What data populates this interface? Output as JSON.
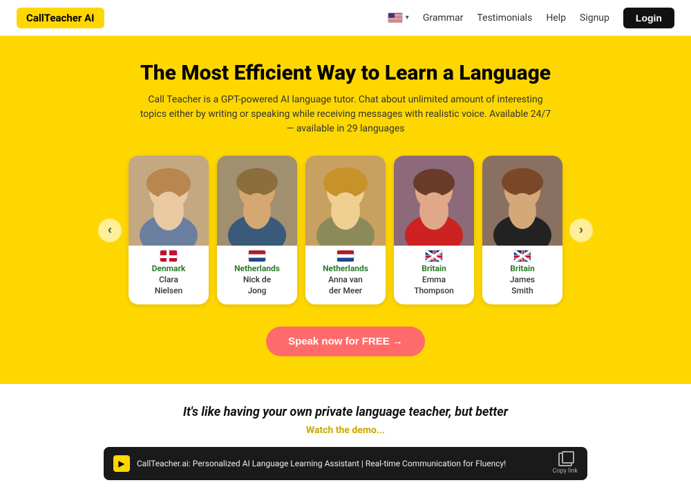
{
  "brand": {
    "logo": "CallTeacher AI"
  },
  "nav": {
    "links": [
      "Grammar",
      "Testimonials",
      "Help",
      "Signup"
    ],
    "login_label": "Login",
    "flag_alt": "US Flag"
  },
  "hero": {
    "title": "The Most Efficient Way to Learn a Language",
    "subtitle": "Call Teacher is a GPT-powered AI language tutor. Chat about unlimited amount of interesting topics either by writing or speaking while receiving messages with realistic voice. Available 24/7 — available in 29 languages",
    "carousel_prev": "‹",
    "carousel_next": "›",
    "cta_label": "Speak now for FREE →"
  },
  "teachers": [
    {
      "country": "Denmark",
      "country_color": "#2a7a2a",
      "name": "Clara\nNielsen",
      "flag_type": "dk",
      "emoji": "👩"
    },
    {
      "country": "Netherlands",
      "country_color": "#2a7a2a",
      "name": "Nick de\nJong",
      "flag_type": "nl",
      "emoji": "👨"
    },
    {
      "country": "Netherlands",
      "country_color": "#2a7a2a",
      "name": "Anna van\nder Meer",
      "flag_type": "nl",
      "emoji": "👩"
    },
    {
      "country": "Britain",
      "country_color": "#2a7a2a",
      "name": "Emma\nThompson",
      "flag_type": "gb",
      "emoji": "👩"
    },
    {
      "country": "Britain",
      "country_color": "#2a7a2a",
      "name": "James\nSmith",
      "flag_type": "gb",
      "emoji": "👨"
    }
  ],
  "bottom": {
    "tagline": "It's like having your own private language teacher, but better",
    "watch_demo": "Watch the demo...",
    "video_title": "CallTeacher.ai: Personalized AI Language Learning Assistant | Real-time Communication for Fluency!",
    "copy_label": "Copy link"
  }
}
